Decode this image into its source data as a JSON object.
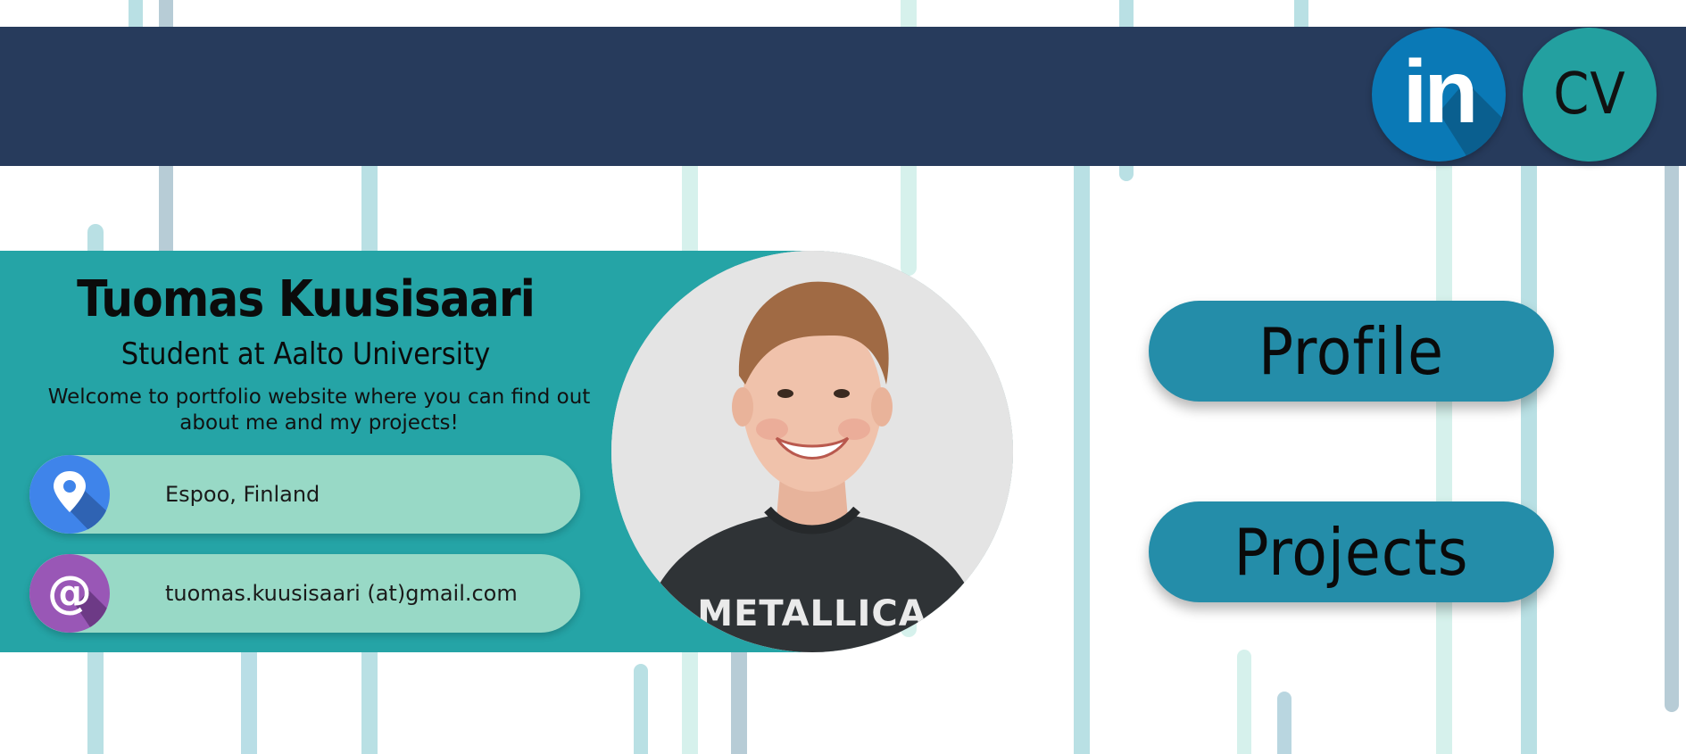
{
  "header": {
    "linkedin": {
      "icon": "linkedin-icon",
      "label": "in",
      "color": "#0a79b6"
    },
    "cv": {
      "label": "CV",
      "color": "#23a0a0"
    },
    "background_color": "#273b5c"
  },
  "intro": {
    "name": "Tuomas Kuusisaari",
    "subtitle": "Student at Aalto University",
    "welcome": "Welcome to portfolio website where you can find out about me and my projects!",
    "background_color": "#25a4a6",
    "location": {
      "icon": "map-pin-icon",
      "text": "Espoo, Finland"
    },
    "email": {
      "icon": "at-sign-icon",
      "text": "tuomas.kuusisaari (at)gmail.com"
    },
    "photo": {
      "shirt_text": "METALLICA"
    }
  },
  "nav": {
    "profile_label": "Profile",
    "projects_label": "Projects",
    "button_color": "#248da9"
  }
}
